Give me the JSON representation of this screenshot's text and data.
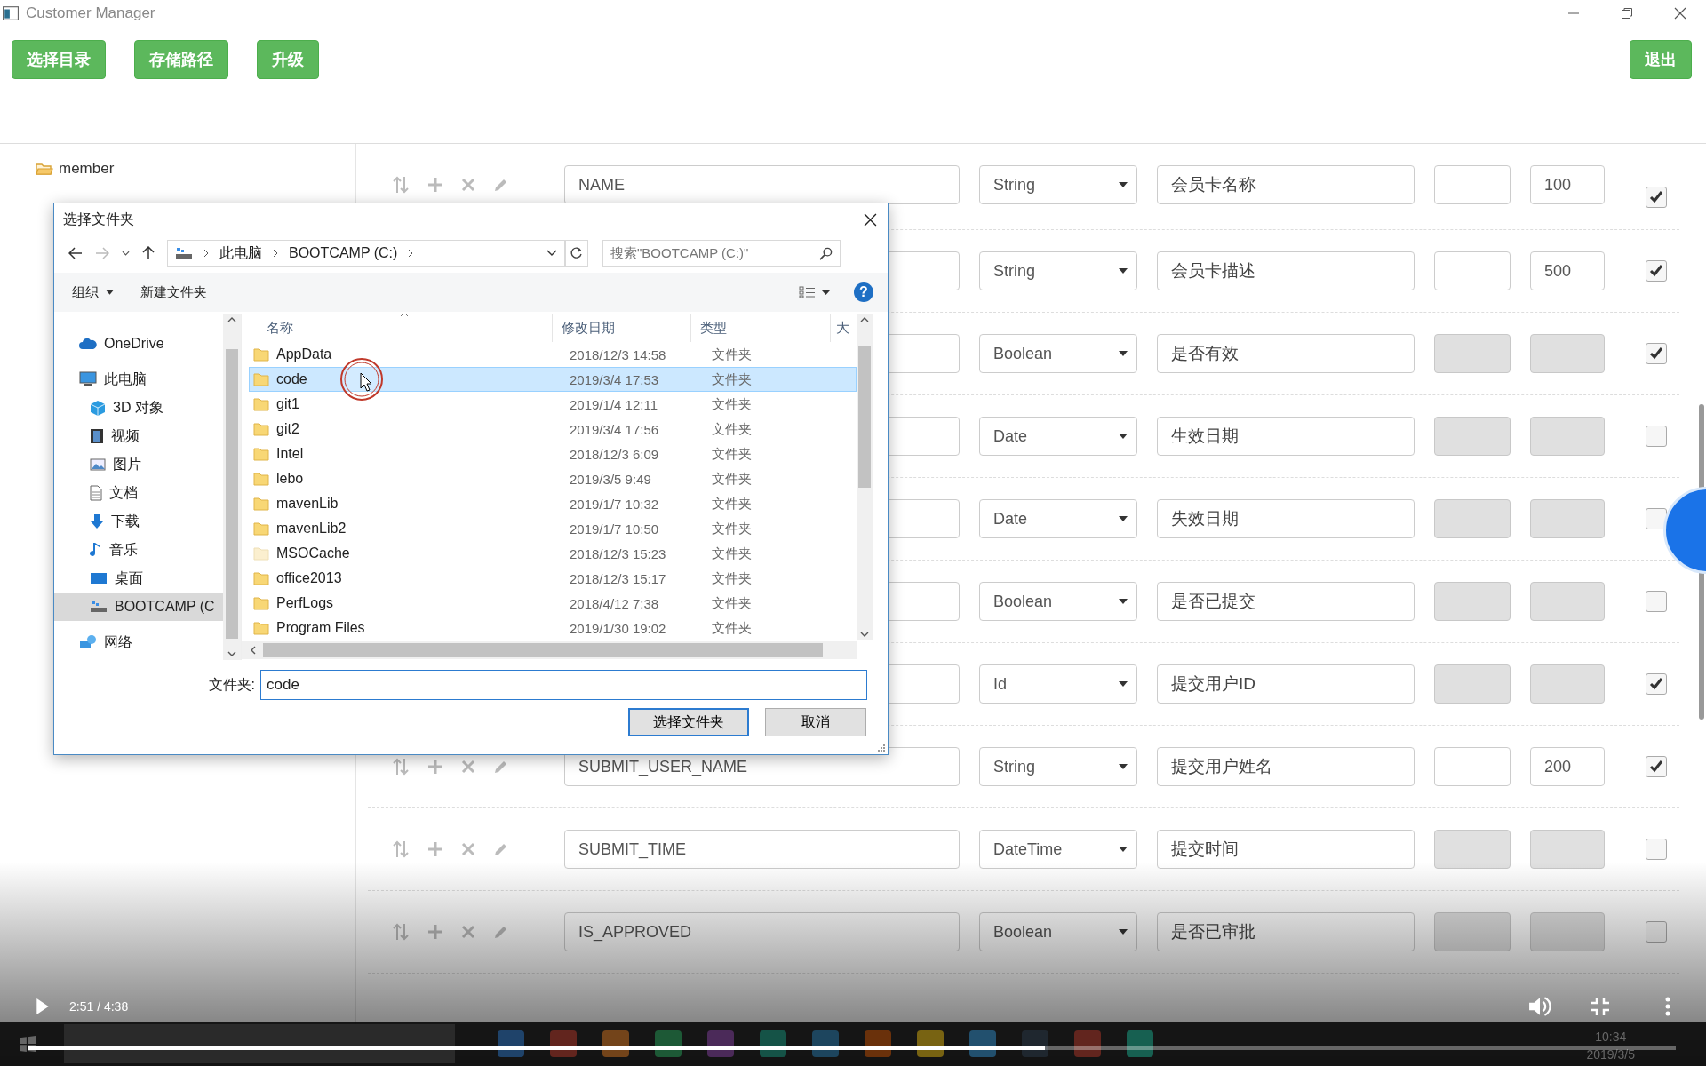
{
  "window": {
    "title": "Customer Manager"
  },
  "toolbar": {
    "buttons": [
      "选择目录",
      "存储路径",
      "升级"
    ],
    "exit_button": "退出"
  },
  "tree": {
    "items": [
      {
        "label": "member"
      }
    ]
  },
  "fields": [
    {
      "name": "NAME",
      "type": "String",
      "comment": "会员卡名称",
      "length": "100",
      "disabled": false,
      "checked": true
    },
    {
      "type": "String",
      "comment": "会员卡描述",
      "length": "500",
      "disabled": false,
      "checked": true
    },
    {
      "type": "Boolean",
      "comment": "是否有效",
      "disabled": true,
      "checked": true
    },
    {
      "type": "Date",
      "comment": "生效日期",
      "disabled": true,
      "checked": false
    },
    {
      "type": "Date",
      "comment": "失效日期",
      "disabled": true,
      "checked": false
    },
    {
      "type": "Boolean",
      "comment": "是否已提交",
      "disabled": true,
      "checked": false
    },
    {
      "type": "Id",
      "comment": "提交用户ID",
      "disabled": true,
      "checked": true
    },
    {
      "name": "SUBMIT_USER_NAME",
      "type": "String",
      "comment": "提交用户姓名",
      "length": "200",
      "disabled": false,
      "checked": true
    },
    {
      "name": "SUBMIT_TIME",
      "type": "DateTime",
      "comment": "提交时间",
      "disabled": true,
      "checked": false
    },
    {
      "name": "IS_APPROVED",
      "type": "Boolean",
      "comment": "是否已审批",
      "disabled": true,
      "checked": false
    }
  ],
  "dialog": {
    "title": "选择文件夹",
    "path": [
      "此电脑",
      "BOOTCAMP (C:)"
    ],
    "search_placeholder": "搜索\"BOOTCAMP (C:)\"",
    "organize": "组织",
    "new_folder": "新建文件夹",
    "help": "?",
    "nav": [
      {
        "label": "OneDrive",
        "kind": "cloud",
        "selected": false
      },
      {
        "label": "此电脑",
        "kind": "pc",
        "selected": false,
        "children": [
          {
            "label": "3D 对象",
            "kind": "cube",
            "selected": false
          },
          {
            "label": "视频",
            "kind": "film",
            "selected": false
          },
          {
            "label": "图片",
            "kind": "image",
            "selected": false
          },
          {
            "label": "文档",
            "kind": "document",
            "selected": false
          },
          {
            "label": "下载",
            "kind": "download",
            "selected": false
          },
          {
            "label": "音乐",
            "kind": "music",
            "selected": false
          },
          {
            "label": "桌面",
            "kind": "desktop",
            "selected": false
          },
          {
            "label": "BOOTCAMP (C",
            "kind": "drive",
            "selected": true
          }
        ]
      },
      {
        "label": "网络",
        "kind": "network",
        "selected": false
      }
    ],
    "columns": [
      "名称",
      "修改日期",
      "类型",
      "大"
    ],
    "files": [
      {
        "name": "AppData",
        "modified": "2018/12/3 14:58",
        "type": "文件夹",
        "hidden": false,
        "selected": false
      },
      {
        "name": "code",
        "modified": "2019/3/4 17:53",
        "type": "文件夹",
        "hidden": false,
        "selected": true
      },
      {
        "name": "git1",
        "modified": "2019/1/4 12:11",
        "type": "文件夹",
        "hidden": false,
        "selected": false
      },
      {
        "name": "git2",
        "modified": "2019/3/4 17:56",
        "type": "文件夹",
        "hidden": false,
        "selected": false
      },
      {
        "name": "Intel",
        "modified": "2018/12/3 6:09",
        "type": "文件夹",
        "hidden": false,
        "selected": false
      },
      {
        "name": "lebo",
        "modified": "2019/3/5 9:49",
        "type": "文件夹",
        "hidden": false,
        "selected": false
      },
      {
        "name": "mavenLib",
        "modified": "2019/1/7 10:32",
        "type": "文件夹",
        "hidden": false,
        "selected": false
      },
      {
        "name": "mavenLib2",
        "modified": "2019/1/7 10:50",
        "type": "文件夹",
        "hidden": false,
        "selected": false
      },
      {
        "name": "MSOCache",
        "modified": "2018/12/3 15:23",
        "type": "文件夹",
        "hidden": true,
        "selected": false
      },
      {
        "name": "office2013",
        "modified": "2018/12/3 15:17",
        "type": "文件夹",
        "hidden": false,
        "selected": false
      },
      {
        "name": "PerfLogs",
        "modified": "2018/4/12 7:38",
        "type": "文件夹",
        "hidden": false,
        "selected": false
      },
      {
        "name": "Program Files",
        "modified": "2019/1/30 19:02",
        "type": "文件夹",
        "hidden": false,
        "selected": false
      }
    ],
    "folder_label": "文件夹:",
    "folder_value": "code",
    "buttons": [
      "选择文件夹",
      "取消"
    ]
  },
  "video_player": {
    "time": "2:51 / 4:38",
    "level": 0.617
  },
  "taskbar": {
    "time": "10:34",
    "date": "2019/3/5"
  }
}
